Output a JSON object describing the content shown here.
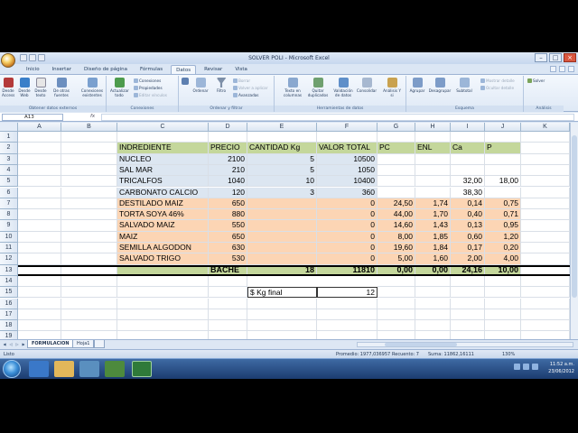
{
  "window": {
    "title": "SOLVER POLI - Microsoft Excel"
  },
  "ribbon_tabs": [
    "Inicio",
    "Insertar",
    "Diseño de página",
    "Fórmulas",
    "Datos",
    "Revisar",
    "Vista"
  ],
  "active_tab": "Datos",
  "ribbon": {
    "groups": [
      "Obtener datos externos",
      "Conexiones",
      "Ordenar y filtrar",
      "Herramientas de datos",
      "Esquema",
      "Análisis"
    ],
    "btn_access": "Desde Access",
    "btn_web": "Desde Web",
    "btn_text": "Desde texto",
    "btn_other": "De otras fuentes",
    "btn_existing": "Conexiones existentes",
    "btn_refresh": "Actualizar todo",
    "conn_connections": "Conexiones",
    "conn_properties": "Propiedades",
    "conn_edit": "Editar vínculos",
    "btn_sort": "Ordenar",
    "btn_filter": "Filtro",
    "filter_clear": "Borrar",
    "filter_reapply": "Volver a aplicar",
    "filter_advanced": "Avanzadas",
    "btn_text_cols": "Texto en columnas",
    "btn_remove_dup": "Quitar duplicados",
    "btn_validation": "Validación de datos",
    "btn_consolidate": "Consolidar",
    "btn_whatif": "Análisis Y si",
    "btn_group": "Agrupar",
    "btn_ungroup": "Desagrupar",
    "btn_subtotal": "Subtotal",
    "outline_show": "Mostrar detalle",
    "outline_hide": "Ocultar detalle",
    "btn_solver": "Solver"
  },
  "formula_bar": {
    "name_box": "A13",
    "fx": "fx",
    "value": ""
  },
  "columns": [
    "A",
    "B",
    "C",
    "D",
    "E",
    "F",
    "G",
    "H",
    "I",
    "J",
    "K"
  ],
  "rows": [
    "1",
    "2",
    "3",
    "4",
    "5",
    "6",
    "7",
    "8",
    "9",
    "10",
    "11",
    "12",
    "13",
    "14",
    "15",
    "16",
    "17",
    "18",
    "19"
  ],
  "table": {
    "headers": [
      "INDREDIENTE",
      "PRECIO",
      "CANTIDAD Kg",
      "VALOR TOTAL",
      "PC",
      "ENL",
      "Ca",
      "P"
    ],
    "rows": [
      [
        "NUCLEO",
        "2100",
        "5",
        "10500",
        "",
        "",
        "",
        ""
      ],
      [
        "SAL MAR",
        "210",
        "5",
        "1050",
        "",
        "",
        "",
        ""
      ],
      [
        "TRICALFOS",
        "1040",
        "10",
        "10400",
        "",
        "",
        "32,00",
        "18,00"
      ],
      [
        "CARBONATO CALCIO",
        "120",
        "3",
        "360",
        "",
        "",
        "38,30",
        ""
      ],
      [
        "DESTILADO MAIZ",
        "650",
        "",
        "0",
        "24,50",
        "1,74",
        "0,14",
        "0,75"
      ],
      [
        "TORTA SOYA 46%",
        "880",
        "",
        "0",
        "44,00",
        "1,70",
        "0,40",
        "0,71"
      ],
      [
        "SALVADO MAIZ",
        "550",
        "",
        "0",
        "14,60",
        "1,43",
        "0,13",
        "0,95"
      ],
      [
        "MAIZ",
        "650",
        "",
        "0",
        "8,00",
        "1,85",
        "0,60",
        "1,20"
      ],
      [
        "SEMILLA ALGODON",
        "630",
        "",
        "0",
        "19,60",
        "1,84",
        "0,17",
        "0,20"
      ],
      [
        "SALVADO TRIGO",
        "530",
        "",
        "0",
        "5,00",
        "1,60",
        "2,00",
        "4,00"
      ]
    ],
    "total_row": [
      "BACHE",
      "18",
      "11810",
      "0,00",
      "0,00",
      "24,16",
      "10,00"
    ],
    "kg_final_label": "$ Kg final",
    "kg_final_value": "12"
  },
  "sheets": [
    "FORMULACION",
    "Hoja1"
  ],
  "active_sheet": "FORMULACION",
  "status": {
    "mode": "Listo",
    "average": "Promedio: 1977,036957",
    "count": "Recuento: 7",
    "sum": "Suma: 11862,16111",
    "zoom": "130%"
  },
  "taskbar": {
    "time": "11:52 a.m.",
    "date": "23/06/2012"
  },
  "colors": {
    "green": "#c4d79b",
    "blue": "#dce6f1",
    "peach": "#fcd5b4"
  }
}
